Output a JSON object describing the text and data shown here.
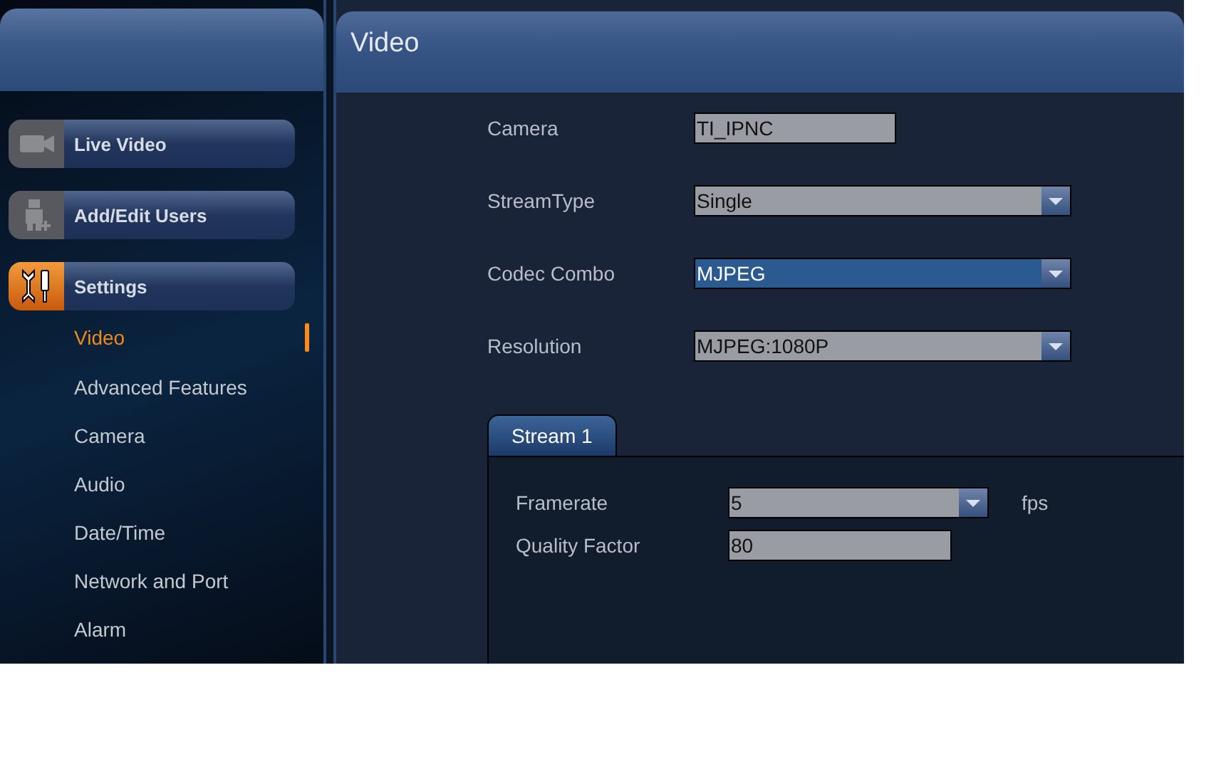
{
  "sidebar": {
    "nav_buttons": [
      {
        "label": "Live Video",
        "selected": false
      },
      {
        "label": "Add/Edit Users",
        "selected": false
      },
      {
        "label": "Settings",
        "selected": true
      }
    ],
    "sub_items": [
      {
        "label": "Video",
        "selected": true
      },
      {
        "label": "Advanced Features",
        "selected": false
      },
      {
        "label": "Camera",
        "selected": false
      },
      {
        "label": "Audio",
        "selected": false
      },
      {
        "label": "Date/Time",
        "selected": false
      },
      {
        "label": "Network and Port",
        "selected": false
      },
      {
        "label": "Alarm",
        "selected": false
      }
    ]
  },
  "main": {
    "title": "Video",
    "fields": [
      {
        "label": "Camera",
        "kind": "text",
        "value": "TI_IPNC"
      },
      {
        "label": "StreamType",
        "kind": "select",
        "value": "Single",
        "focused": false
      },
      {
        "label": "Codec Combo",
        "kind": "select",
        "value": "MJPEG",
        "focused": true
      },
      {
        "label": "Resolution",
        "kind": "select",
        "value": "MJPEG:1080P",
        "focused": false
      }
    ],
    "tabs": [
      {
        "label": "Stream 1",
        "selected": true
      }
    ],
    "stream_fields": [
      {
        "label": "Framerate",
        "kind": "select",
        "value": "5",
        "unit": "fps"
      },
      {
        "label": "Quality Factor",
        "kind": "text",
        "value": "80"
      }
    ]
  }
}
